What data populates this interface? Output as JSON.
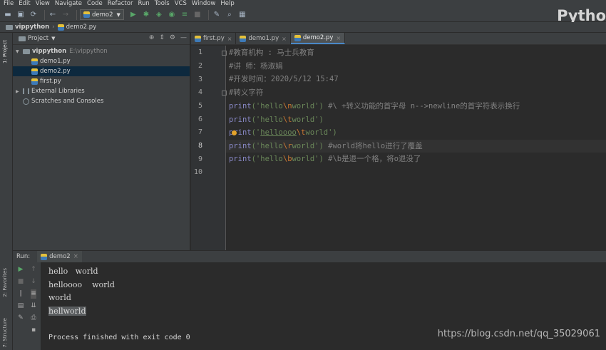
{
  "menu": [
    "File",
    "Edit",
    "View",
    "Navigate",
    "Code",
    "Refactor",
    "Run",
    "Tools",
    "VCS",
    "Window",
    "Help"
  ],
  "toolbar": {
    "run_config": "demo2",
    "brand": "Pytho"
  },
  "breadcrumb": [
    "vippython",
    "demo2.py"
  ],
  "left_stripe": {
    "project_label": "1: Project",
    "favorites_label": "2: Favorites",
    "structure_label": "7: Structure"
  },
  "project": {
    "header": "Project",
    "root": {
      "name": "vippython",
      "path": "E:\\vippython"
    },
    "files": [
      "demo1.py",
      "demo2.py",
      "first.py"
    ],
    "selected": "demo2.py",
    "external": "External Libraries",
    "scratches": "Scratches and Consoles"
  },
  "editor": {
    "tabs": [
      {
        "label": "first.py",
        "active": false
      },
      {
        "label": "demo1.py",
        "active": false
      },
      {
        "label": "demo2.py",
        "active": true
      }
    ],
    "line_numbers": [
      "1",
      "2",
      "3",
      "4",
      "5",
      "6",
      "7",
      "8",
      "9",
      "10"
    ],
    "lines": {
      "l1": "#教育机构 : 马士兵教育",
      "l2": "#讲    师：杨淑娟",
      "l3": "#开发时间：2020/5/12 15:47",
      "l4": "#转义字符",
      "l5_fn": "print",
      "l5_open": "('",
      "l5_a": "hello",
      "l5_esc": "\\n",
      "l5_b": "world",
      "l5_close": "')",
      "l5_comment": "  #\\  +转义功能的首字母   n-->newline的首字符表示换行",
      "l6_fn": "print",
      "l6_open": "('",
      "l6_a": "hello",
      "l6_esc": "\\t",
      "l6_b": "world",
      "l6_close": "')",
      "l7_fn": "print",
      "l7_open": "('",
      "l7_a": "helloooo",
      "l7_esc": "\\t",
      "l7_b": "world",
      "l7_close": "')",
      "l8_fn": "print",
      "l8_open": "('",
      "l8_a": "hello",
      "l8_esc": "\\r",
      "l8_b": "world",
      "l8_close": "')",
      "l8_comment": "  #world将hello进行了覆盖",
      "l9_fn": "print",
      "l9_open": "('",
      "l9_a": "hello",
      "l9_esc": "\\b",
      "l9_b": "world",
      "l9_close": "')",
      "l9_comment": " #\\b是退一个格，将o退没了"
    }
  },
  "run": {
    "label": "Run:",
    "tab": "demo2",
    "output": [
      "hello   world",
      "helloooo    world",
      "world",
      "hellworld",
      "Process finished with exit code 0"
    ]
  },
  "watermark": "https://blog.csdn.net/qq_35029061"
}
